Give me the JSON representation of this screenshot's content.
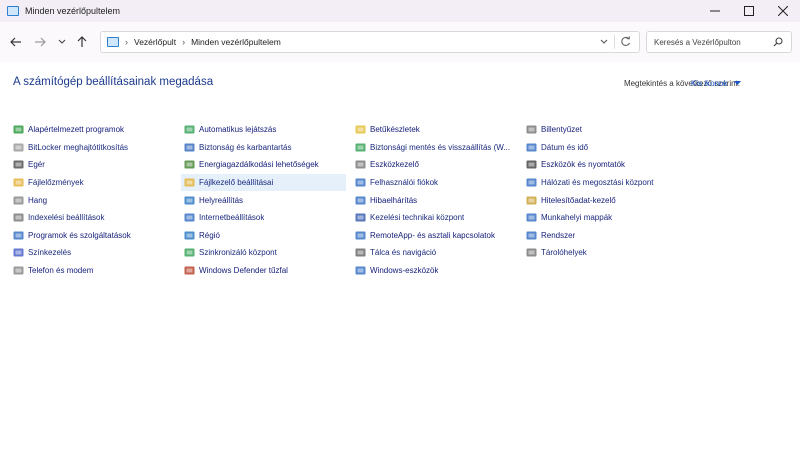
{
  "window": {
    "title": "Minden vezérlőpultelem"
  },
  "address": {
    "crumbs": [
      "Vezérlőpult",
      "Minden vezérlőpultelem"
    ]
  },
  "search": {
    "placeholder": "Keresés a Vezérlőpulton"
  },
  "heading": "A számítógép beállításainak megadása",
  "viewby": {
    "label": "Megtekintés a következő szerint:",
    "value": "Kis ikonok"
  },
  "columns": [
    [
      {
        "label": "Alapértelmezett programok",
        "icon": "#2e9a3e"
      },
      {
        "label": "BitLocker meghajtótitkosítás",
        "icon": "#9a9a9a"
      },
      {
        "label": "Egér",
        "icon": "#555555"
      },
      {
        "label": "Fájlelőzmények",
        "icon": "#e3b33a"
      },
      {
        "label": "Hang",
        "icon": "#8a8a8a"
      },
      {
        "label": "Indexelési beállítások",
        "icon": "#7a7a7a"
      },
      {
        "label": "Programok és szolgáltatások",
        "icon": "#3a72c4"
      },
      {
        "label": "Színkezelés",
        "icon": "#4a63c8"
      },
      {
        "label": "Telefon és modem",
        "icon": "#8a8a8a"
      }
    ],
    [
      {
        "label": "Automatikus lejátszás",
        "icon": "#3aa35a"
      },
      {
        "label": "Biztonság és karbantartás",
        "icon": "#3a6fc0"
      },
      {
        "label": "Energiagazdálkodási lehetőségek",
        "icon": "#4a8a3a"
      },
      {
        "label": "Fájlkezelő beállításai",
        "icon": "#e3b33a"
      },
      {
        "label": "Helyreállítás",
        "icon": "#2e7ac4"
      },
      {
        "label": "Internetbeállítások",
        "icon": "#3a72c4"
      },
      {
        "label": "Régió",
        "icon": "#2e7ac4"
      },
      {
        "label": "Szinkronizáló központ",
        "icon": "#3aa35a"
      },
      {
        "label": "Windows Defender tűzfal",
        "icon": "#b8452e"
      }
    ],
    [
      {
        "label": "Betűkészletek",
        "icon": "#e3c03a"
      },
      {
        "label": "Biztonsági mentés és visszaállítás (W...",
        "icon": "#3aa35a"
      },
      {
        "label": "Eszközkezelő",
        "icon": "#7a7a7a"
      },
      {
        "label": "Felhasználói fiókok",
        "icon": "#3a72c4"
      },
      {
        "label": "Hibaelhárítás",
        "icon": "#3a72c4"
      },
      {
        "label": "Kezelési technikai központ",
        "icon": "#3a5fb0"
      },
      {
        "label": "RemoteApp- és asztali kapcsolatok",
        "icon": "#3a72c4"
      },
      {
        "label": "Tálca és navigáció",
        "icon": "#6a6a6a"
      },
      {
        "label": "Windows-eszközök",
        "icon": "#3a72c4"
      }
    ],
    [
      {
        "label": "Billentyűzet",
        "icon": "#7a7a7a"
      },
      {
        "label": "Dátum és idő",
        "icon": "#3a72c4"
      },
      {
        "label": "Eszközök és nyomtatók",
        "icon": "#4a4a4a"
      },
      {
        "label": "Hálózati és megosztási központ",
        "icon": "#3a72c4"
      },
      {
        "label": "Hitelesítőadat-kezelő",
        "icon": "#c9a23a"
      },
      {
        "label": "Munkahelyi mappák",
        "icon": "#3a72c4"
      },
      {
        "label": "Rendszer",
        "icon": "#3a72c4"
      },
      {
        "label": "Tárolóhelyek",
        "icon": "#7a7a7a"
      }
    ]
  ]
}
